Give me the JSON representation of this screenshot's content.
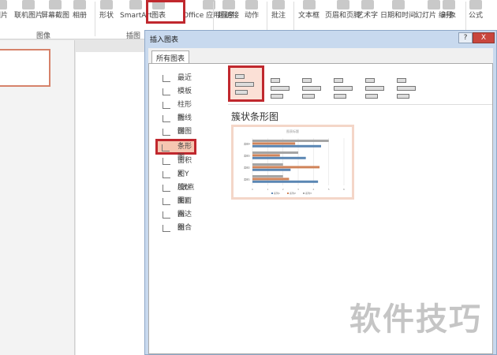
{
  "ribbon": {
    "buttons": [
      "图片",
      "联机图片",
      "屏幕截图",
      "相册",
      "形状",
      "SmartArt",
      "图表",
      "Office 应用程序",
      "超链接",
      "动作",
      "批注",
      "文本框",
      "页眉和页脚",
      "艺术字",
      "日期和时间",
      "幻灯片 编号",
      "对象",
      "公式"
    ],
    "groups": [
      "图像",
      "插图"
    ]
  },
  "dialog": {
    "title": "插入图表",
    "help": "?",
    "close": "X",
    "tab": "所有图表",
    "categories": [
      "最近",
      "模板",
      "柱形图",
      "折线图",
      "饼图",
      "条形图",
      "面积图",
      "X Y (散点图)",
      "股价图",
      "曲面图",
      "雷达图",
      "组合"
    ],
    "selected_category": "条形图",
    "chart_type_title": "簇状条形图"
  },
  "chart_data": {
    "type": "bar",
    "orientation": "horizontal",
    "title": "图表标题",
    "categories": [
      "类别1",
      "类别2",
      "类别3",
      "类别4"
    ],
    "series": [
      {
        "name": "系列1",
        "color": "#5b87b4",
        "values": [
          4.3,
          2.5,
          3.5,
          4.5
        ]
      },
      {
        "name": "系列2",
        "color": "#d0845a",
        "values": [
          2.4,
          4.4,
          1.8,
          2.8
        ]
      },
      {
        "name": "系列3",
        "color": "#a5a5a5",
        "values": [
          2,
          2,
          3,
          5
        ]
      }
    ],
    "xlim": [
      0,
      6
    ],
    "ticks": [
      "0",
      "1",
      "2",
      "3",
      "4",
      "5",
      "6"
    ]
  },
  "watermark": "软件技巧"
}
